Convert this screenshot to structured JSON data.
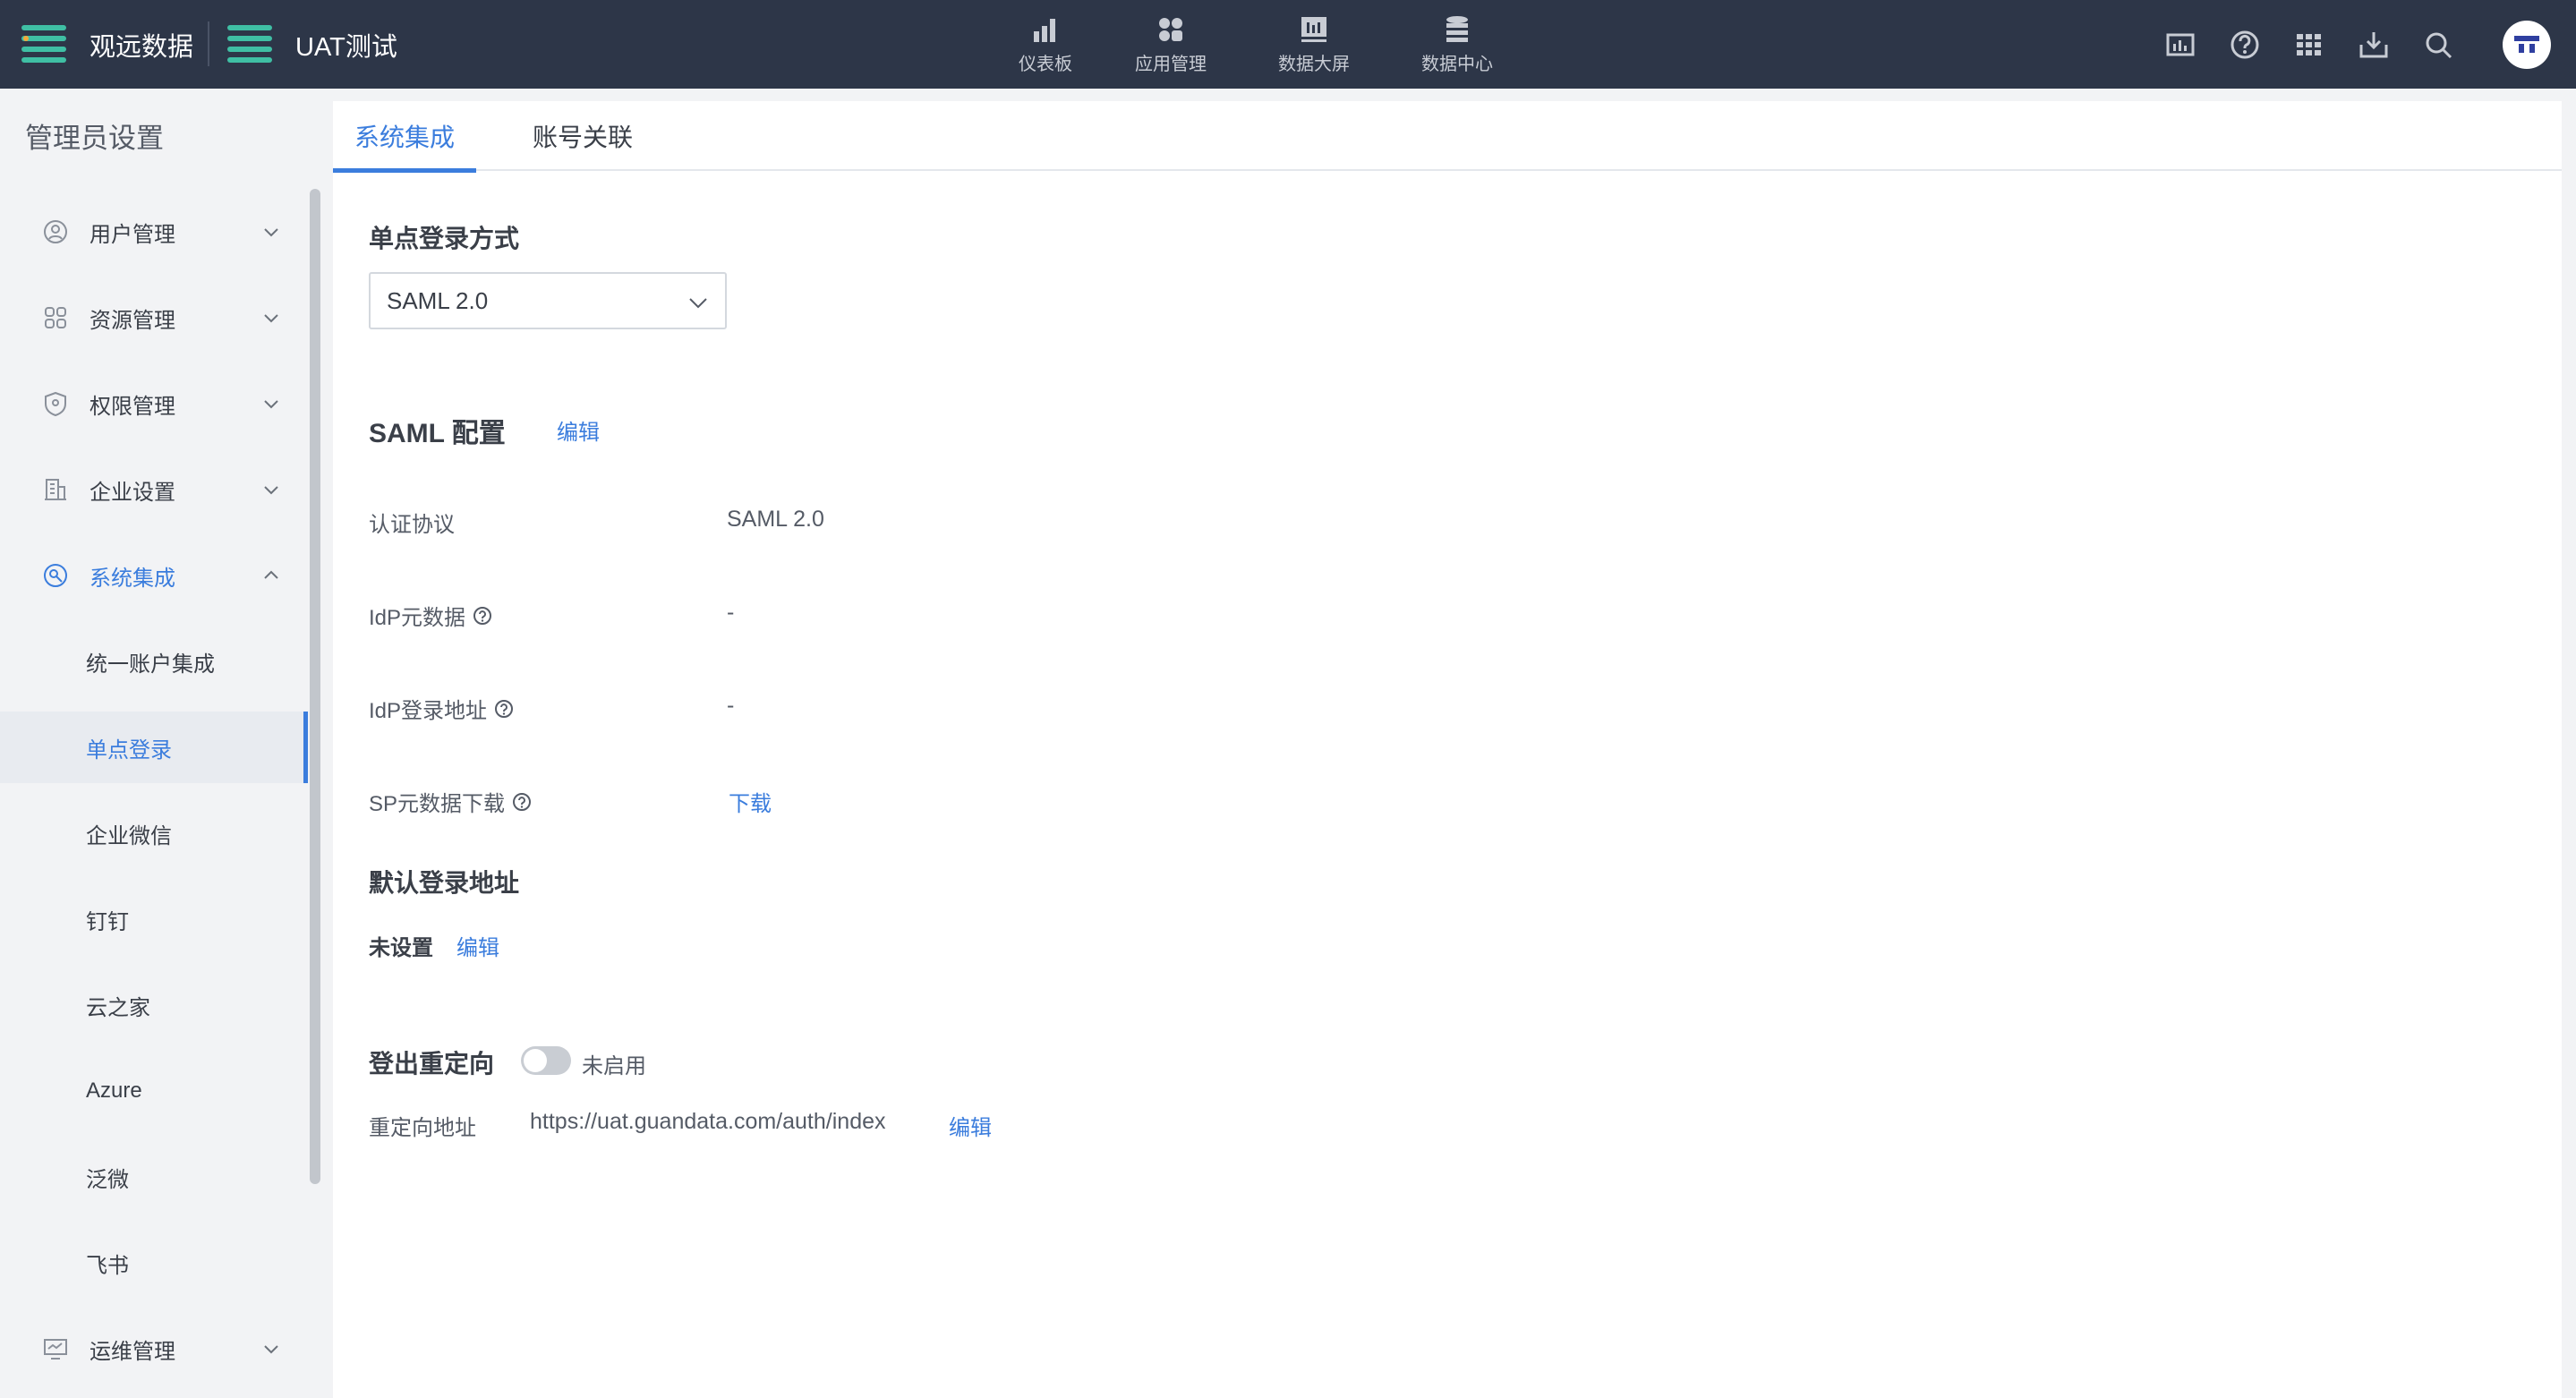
{
  "app": {
    "org_name": "观远数据",
    "env_name": "UAT测试"
  },
  "top_nav": {
    "items": [
      {
        "label": "仪表板",
        "icon": "bar-chart-icon"
      },
      {
        "label": "应用管理",
        "icon": "apps-icon"
      },
      {
        "label": "数据大屏",
        "icon": "screen-icon"
      },
      {
        "label": "数据中心",
        "icon": "database-icon"
      }
    ],
    "right_icons": [
      "chart-board-icon",
      "help-icon",
      "grid-icon",
      "download-tray-icon",
      "search-icon",
      "user-avatar-icon"
    ]
  },
  "sidebar": {
    "title": "管理员设置",
    "menus": [
      {
        "label": "用户管理",
        "icon": "user-icon"
      },
      {
        "label": "资源管理",
        "icon": "resource-icon"
      },
      {
        "label": "权限管理",
        "icon": "shield-icon"
      },
      {
        "label": "企业设置",
        "icon": "building-icon"
      },
      {
        "label": "系统集成",
        "icon": "integration-icon"
      }
    ],
    "submenu": [
      {
        "label": "统一账户集成"
      },
      {
        "label": "单点登录"
      },
      {
        "label": "企业微信"
      },
      {
        "label": "钉钉"
      },
      {
        "label": "云之家"
      },
      {
        "label": "Azure"
      },
      {
        "label": "泛微"
      },
      {
        "label": "飞书"
      }
    ],
    "last_menu": {
      "label": "运维管理",
      "icon": "monitor-icon"
    }
  },
  "tabs": [
    {
      "label": "系统集成"
    },
    {
      "label": "账号关联"
    }
  ],
  "sso": {
    "section_title": "单点登录方式",
    "selected": "SAML 2.0"
  },
  "saml": {
    "title": "SAML 配置",
    "edit": "编辑",
    "fields": [
      {
        "label": "认证协议",
        "value": "SAML 2.0"
      },
      {
        "label": "IdP元数据",
        "value": "-"
      },
      {
        "label": "IdP登录地址",
        "value": "-"
      },
      {
        "label": "SP元数据下载",
        "value": "下载"
      }
    ]
  },
  "default_login": {
    "title": "默认登录地址",
    "status": "未设置",
    "edit": "编辑"
  },
  "logout_redirect": {
    "title": "登出重定向",
    "toggle_state": "未启用",
    "url_label": "重定向地址",
    "url": "https://uat.guandata.com/auth/index",
    "edit": "编辑"
  }
}
